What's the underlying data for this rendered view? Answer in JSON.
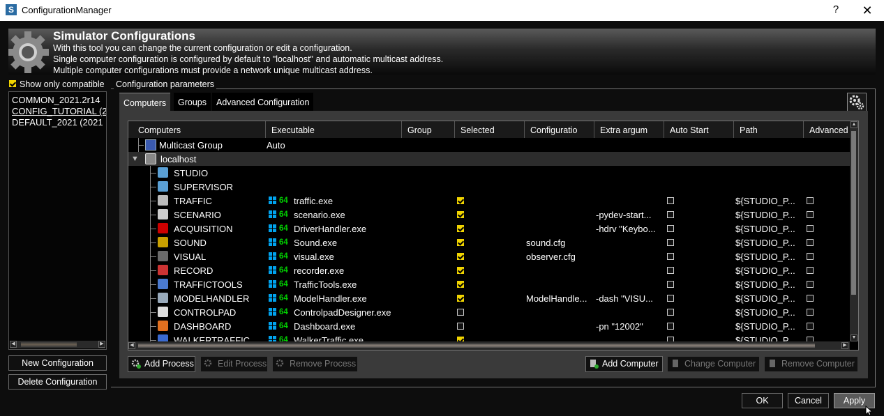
{
  "window": {
    "title": "ConfigurationManager",
    "help": "?",
    "close": "✕",
    "app_icon_letter": "S"
  },
  "header": {
    "title": "Simulator Configurations",
    "lines": [
      "With this tool you can change the current configuration or edit a configuration.",
      "Single computer configuration is configured by default to \"localhost\" and automatic multicast address.",
      "Multiple computer configurations must provide a network unique multicast address."
    ]
  },
  "sidebar": {
    "show_only_compatible": {
      "label": "Show only compatible",
      "checked": true
    },
    "configs": [
      "COMMON_2021.2r14",
      "CONFIG_TUTORIAL (2",
      "DEFAULT_2021 (2021"
    ],
    "new_button": "New Configuration",
    "delete_button": "Delete Configuration"
  },
  "params": {
    "group_label": "Configuration parameters",
    "tabs": [
      "Computers",
      "Groups",
      "Advanced Configuration"
    ],
    "active_tab": "Computers",
    "settings_icon": "gears-icon"
  },
  "grid": {
    "columns": [
      "Computers",
      "Executable",
      "Group",
      "Selected",
      "Configuratio",
      "Extra argum",
      "Auto Start",
      "Path",
      "Advanced"
    ],
    "multicast": {
      "name": "Multicast Group",
      "executable": "Auto",
      "icon": "network-icon"
    },
    "host": {
      "name": "localhost",
      "icon": "computer-icon"
    },
    "bitness": "64",
    "rows": [
      {
        "name": "STUDIO",
        "icon": "studio-icon"
      },
      {
        "name": "SUPERVISOR",
        "icon": "supervisor-icon"
      },
      {
        "name": "TRAFFIC",
        "icon": "traffic-icon",
        "exe": "traffic.exe",
        "selected": true,
        "config": "",
        "args": "",
        "auto": false,
        "path": "${STUDIO_P...",
        "adv": false
      },
      {
        "name": "SCENARIO",
        "icon": "scenario-icon",
        "exe": "scenario.exe",
        "selected": true,
        "config": "",
        "args": "-pydev-start...",
        "auto": false,
        "path": "${STUDIO_P...",
        "adv": false
      },
      {
        "name": "ACQUISITION",
        "icon": "acquisition-icon",
        "exe": "DriverHandler.exe",
        "selected": true,
        "config": "",
        "args": "-hdrv \"Keybo...",
        "auto": false,
        "path": "${STUDIO_P...",
        "adv": false
      },
      {
        "name": "SOUND",
        "icon": "sound-icon",
        "exe": "Sound.exe",
        "selected": true,
        "config": "sound.cfg",
        "args": "",
        "auto": false,
        "path": "${STUDIO_P...",
        "adv": false
      },
      {
        "name": "VISUAL",
        "icon": "visual-icon",
        "exe": "visual.exe",
        "selected": true,
        "config": "observer.cfg",
        "args": "",
        "auto": false,
        "path": "${STUDIO_P...",
        "adv": false
      },
      {
        "name": "RECORD",
        "icon": "record-icon",
        "exe": "recorder.exe",
        "selected": true,
        "config": "",
        "args": "",
        "auto": false,
        "path": "${STUDIO_P...",
        "adv": false
      },
      {
        "name": "TRAFFICTOOLS",
        "icon": "traffictools-icon",
        "exe": "TrafficTools.exe",
        "selected": true,
        "config": "",
        "args": "",
        "auto": false,
        "path": "${STUDIO_P...",
        "adv": false
      },
      {
        "name": "MODELHANDLER",
        "icon": "modelhandler-icon",
        "exe": "ModelHandler.exe",
        "selected": true,
        "config": "ModelHandle...",
        "args": "-dash \"VISU...",
        "auto": false,
        "path": "${STUDIO_P...",
        "adv": false
      },
      {
        "name": "CONTROLPAD",
        "icon": "controlpad-icon",
        "exe": "ControlpadDesigner.exe",
        "selected": false,
        "config": "",
        "args": "",
        "auto": false,
        "path": "${STUDIO_P...",
        "adv": false
      },
      {
        "name": "DASHBOARD",
        "icon": "dashboard-icon",
        "exe": "Dashboard.exe",
        "selected": false,
        "config": "",
        "args": "-pn \"12002\"",
        "auto": false,
        "path": "${STUDIO_P...",
        "adv": false
      },
      {
        "name": "WALKERTRAFFIC",
        "icon": "walker-icon",
        "exe": "WalkerTraffic.exe",
        "selected": true,
        "config": "",
        "args": "",
        "auto": false,
        "path": "${STUDIO_P...",
        "adv": false
      }
    ]
  },
  "actions": {
    "add_process": "Add Process",
    "edit_process": "Edit Process",
    "remove_process": "Remove Process",
    "add_computer": "Add Computer",
    "change_computer": "Change Computer",
    "remove_computer": "Remove Computer"
  },
  "footer": {
    "ok": "OK",
    "cancel": "Cancel",
    "apply": "Apply"
  },
  "colors": {
    "accent_check": "#f1d400",
    "bitness": "#00d000",
    "windows_blue": "#00a2ed"
  }
}
